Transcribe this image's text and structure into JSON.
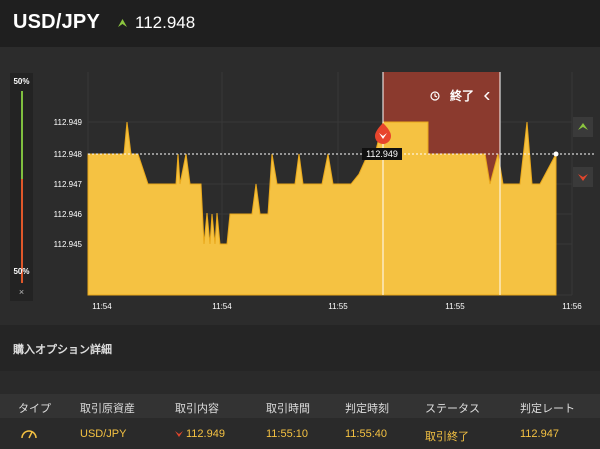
{
  "header": {
    "pair": "USD/JPY",
    "price": "112.948",
    "up_color": "#8cc63f"
  },
  "meter": {
    "top_label": "50%",
    "bottom_label": "50%",
    "close": "×"
  },
  "chart": {
    "y_ticks": [
      "112.949",
      "112.948",
      "112.947",
      "112.946",
      "112.945"
    ],
    "x_ticks": [
      "11:54",
      "11:54",
      "11:55",
      "11:55",
      "11:56"
    ],
    "entry_label": "112.949",
    "expired_text": "終了",
    "fill_color": "#f5c242",
    "expired_color": "#8b3a2e"
  },
  "section": {
    "title": "購入オプション詳細"
  },
  "table": {
    "headers": [
      "タイプ",
      "取引原資産",
      "取引内容",
      "取引時間",
      "判定時刻",
      "ステータス",
      "判定レート"
    ],
    "row": {
      "asset": "USD/JPY",
      "content": "112.949",
      "trade_time": "11:55:10",
      "judge_time": "11:55:40",
      "status": "取引終了",
      "rate": "112.947"
    }
  }
}
